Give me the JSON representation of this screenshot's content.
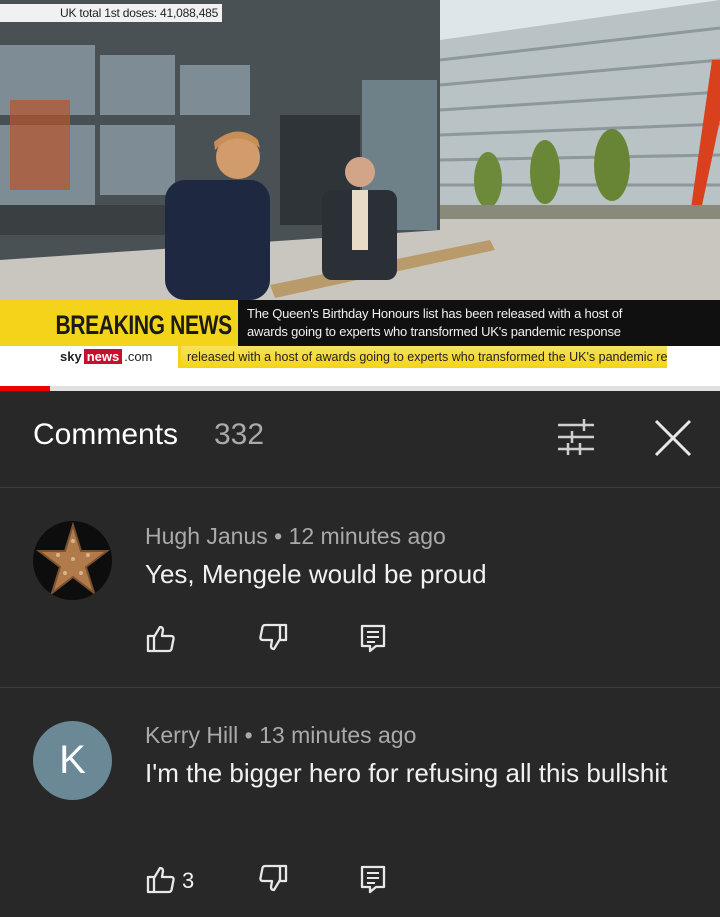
{
  "video": {
    "stat_overlay": "UK total 1st doses: 41,088,485",
    "breaking_label": "BREAKING NEWS",
    "headline_line1": "The Queen's Birthday Honours list has been released with a host of",
    "headline_line2": "awards going to experts who transformed UK's pandemic response",
    "logo": {
      "sky": "sky",
      "news": "news",
      "com": ".com"
    },
    "ticker": "released with a host of awards going to experts who transformed the UK's pandemic re",
    "progress": 0.07
  },
  "comments_panel": {
    "title": "Comments",
    "count": "332",
    "filter_icon": "sliders-icon",
    "close_icon": "close-icon"
  },
  "comments": [
    {
      "author": "Hugh Janus",
      "time": "12 minutes ago",
      "meta": "Hugh Janus • 12 minutes ago",
      "text": "Yes, Mengele would be proud",
      "likes": "",
      "avatar_icon": "starfish-avatar"
    },
    {
      "author": "Kerry Hill",
      "time": "13 minutes ago",
      "meta": "Kerry Hill • 13 minutes ago",
      "text": "I'm the bigger hero for refusing all this bullshit",
      "likes": "3",
      "avatar_letter": "K"
    }
  ],
  "colors": {
    "background": "#282828",
    "breaking_yellow": "#f3d41b",
    "avatar_k": "#6a8895"
  }
}
